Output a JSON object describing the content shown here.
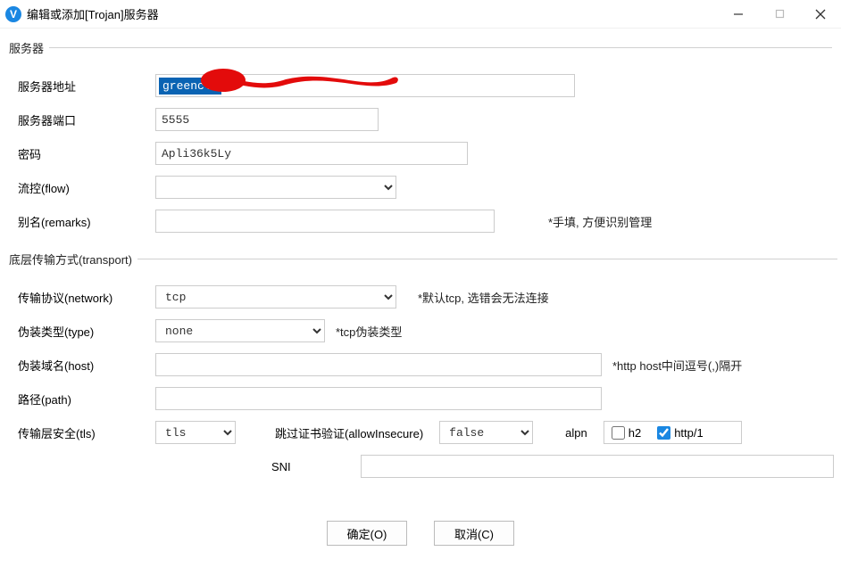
{
  "window": {
    "title": "编辑或添加[Trojan]服务器",
    "icon_letter": "V"
  },
  "groups": {
    "server": "服务器",
    "transport": "底层传输方式(transport)"
  },
  "labels": {
    "address": "服务器地址",
    "port": "服务器端口",
    "password": "密码",
    "flow": "流控(flow)",
    "remarks": "别名(remarks)",
    "network": "传输协议(network)",
    "type": "伪装类型(type)",
    "host": "伪装域名(host)",
    "path": "路径(path)",
    "tls": "传输层安全(tls)",
    "allow_insecure": "跳过证书验证(allowInsecure)",
    "alpn": "alpn",
    "sni": "SNI"
  },
  "values": {
    "address_visible": "greenclo",
    "port": "5555",
    "password": "Apli36k5Ly",
    "flow": "",
    "remarks": "",
    "network": "tcp",
    "type": "none",
    "host": "",
    "path": "",
    "tls": "tls",
    "allow_insecure": "false",
    "h2_checked": false,
    "http1_checked": true,
    "sni": ""
  },
  "alpn_options": {
    "h2": "h2",
    "http1": "http/1"
  },
  "hints": {
    "remarks": "*手填, 方便识别管理",
    "network": "*默认tcp, 选错会无法连接",
    "type": "*tcp伪装类型",
    "host": "*http host中间逗号(,)隔开"
  },
  "buttons": {
    "ok": "确定(O)",
    "cancel": "取消(C)"
  }
}
